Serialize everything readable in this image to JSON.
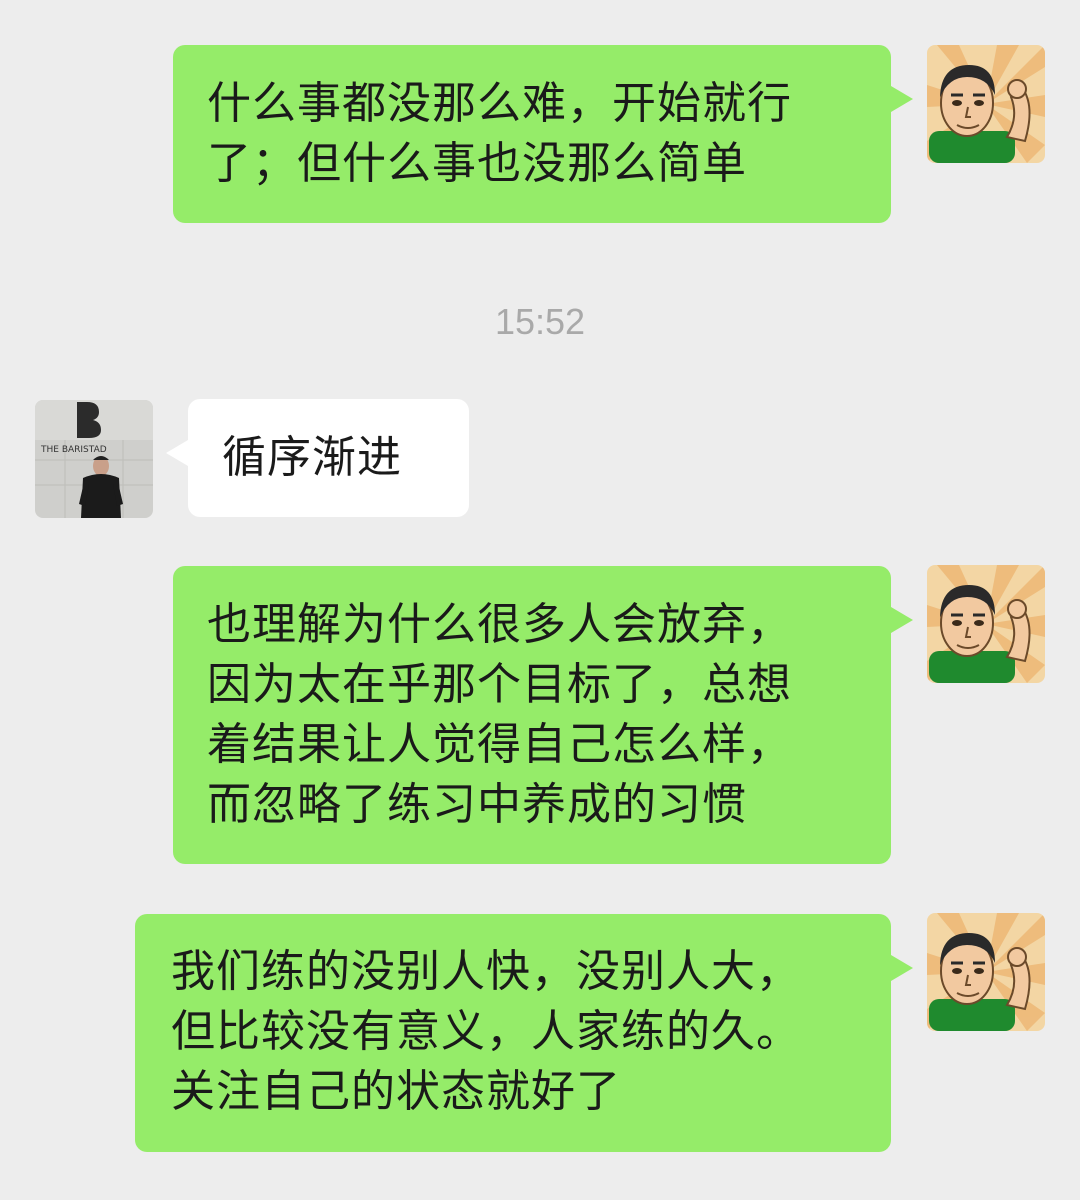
{
  "chat": {
    "messages": [
      {
        "side": "out",
        "sender_avatar": "cartoon-man-flexing-avatar",
        "lines": [
          "什么事都没那么难，开始就行",
          "了；但什么事也没那么简单"
        ]
      },
      {
        "side": "in",
        "sender_avatar": "man-in-black-tshirt-photo-avatar",
        "lines": [
          "循序渐进"
        ]
      },
      {
        "side": "out",
        "sender_avatar": "cartoon-man-flexing-avatar",
        "lines": [
          "也理解为什么很多人会放弃，",
          "因为太在乎那个目标了，总想",
          "着结果让人觉得自己怎么样，",
          "而忽略了练习中养成的习惯"
        ]
      },
      {
        "side": "out",
        "sender_avatar": "cartoon-man-flexing-avatar",
        "lines": [
          "我们练的没别人快，没别人大，",
          "但比较没有意义，人家练的久。",
          "关注自己的状态就好了"
        ]
      }
    ],
    "timestamp": "15:52",
    "avatar_photo_text": "THE BARISTAD"
  },
  "colors": {
    "background": "#ededed",
    "outgoing_bubble": "#95ec69",
    "incoming_bubble": "#ffffff",
    "timestamp_text": "#a9a9a9"
  }
}
